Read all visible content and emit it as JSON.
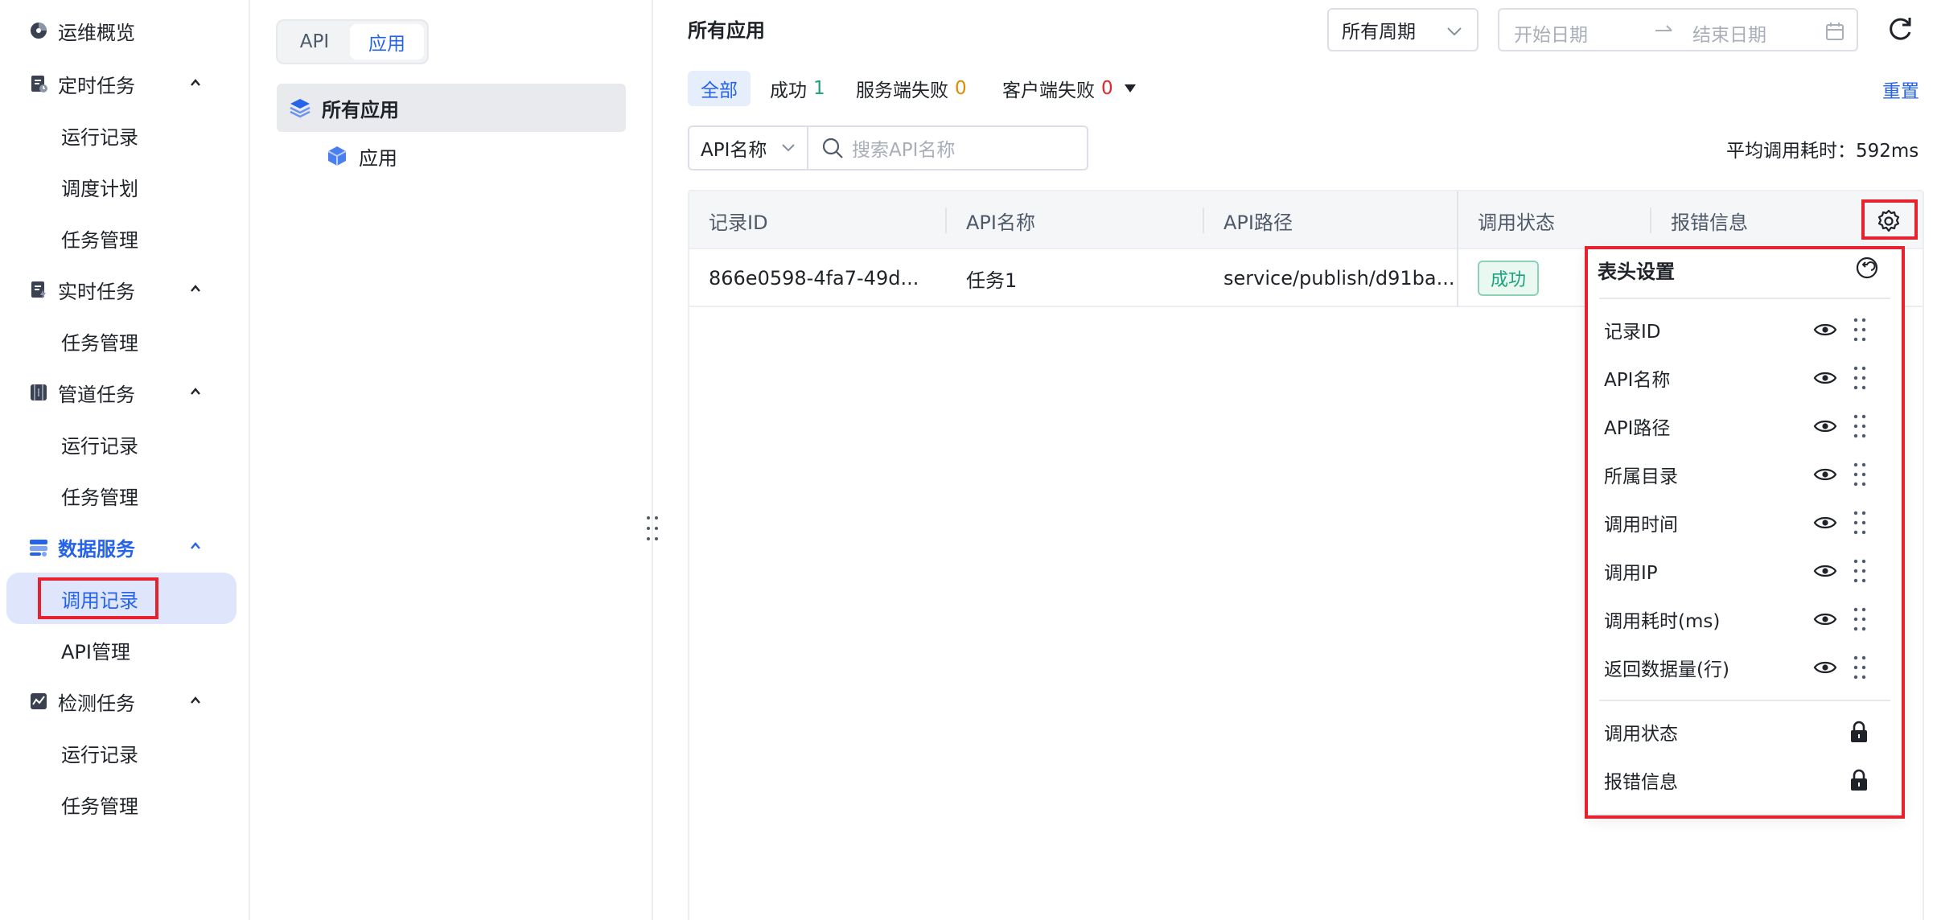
{
  "nav": {
    "overview": "运维概览",
    "scheduled": {
      "label": "定时任务",
      "items": [
        "运行记录",
        "调度计划",
        "任务管理"
      ]
    },
    "realtime": {
      "label": "实时任务",
      "items": [
        "任务管理"
      ]
    },
    "pipeline": {
      "label": "管道任务",
      "items": [
        "运行记录",
        "任务管理"
      ]
    },
    "dataservice": {
      "label": "数据服务",
      "items": [
        "调用记录",
        "API管理"
      ],
      "active_item": "调用记录"
    },
    "inspection": {
      "label": "检测任务",
      "items": [
        "运行记录",
        "任务管理"
      ]
    }
  },
  "tree": {
    "tabs": [
      "API",
      "应用"
    ],
    "active_tab": "应用",
    "root": "所有应用",
    "child": "应用"
  },
  "main": {
    "title": "所有应用",
    "period": "所有周期",
    "date_start_placeholder": "开始日期",
    "date_end_placeholder": "结束日期",
    "filters": {
      "all": "全部",
      "success": "成功",
      "success_count": "1",
      "server_fail": "服务端失败",
      "server_fail_count": "0",
      "client_fail": "客户端失败",
      "client_fail_count": "0"
    },
    "reset": "重置",
    "search_field": "API名称",
    "search_placeholder": "搜索API名称",
    "avg_latency": "平均调用耗时：592ms"
  },
  "table": {
    "columns": [
      "记录ID",
      "API名称",
      "API路径",
      "调用状态",
      "报错信息"
    ],
    "rows": [
      {
        "id": "866e0598-4fa7-49d...",
        "name": "任务1",
        "path": "service/publish/d91ba...",
        "status": "成功"
      }
    ]
  },
  "column_settings": {
    "title": "表头设置",
    "visible_columns": [
      "记录ID",
      "API名称",
      "API路径",
      "所属目录",
      "调用时间",
      "调用IP",
      "调用耗时(ms)",
      "返回数据量(行)"
    ],
    "locked_columns": [
      "调用状态",
      "报错信息"
    ]
  },
  "colors": {
    "accent": "#2563eb",
    "success": "#1aa37a",
    "warning": "#e08a00",
    "danger": "#e5222d",
    "highlight_box": "#e5222d"
  }
}
